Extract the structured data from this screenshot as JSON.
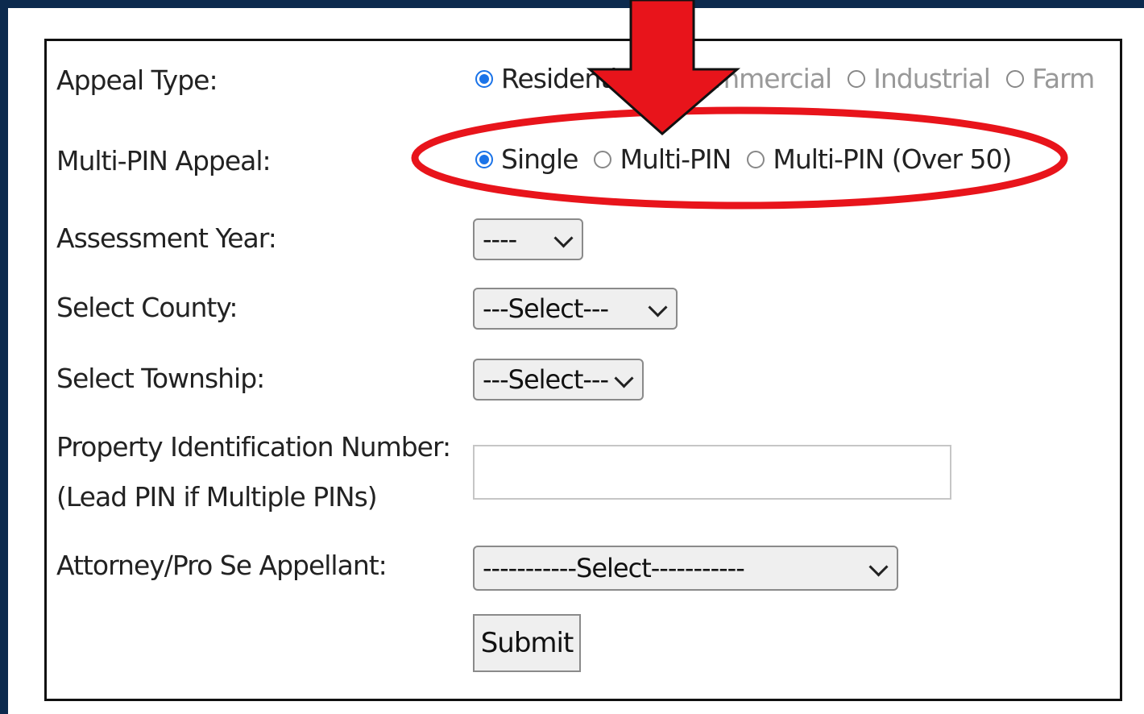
{
  "form": {
    "appeal_type": {
      "label": "Appeal Type:",
      "options": [
        {
          "label": "Residential",
          "checked": true
        },
        {
          "label": "Commercial",
          "checked": false
        },
        {
          "label": "Industrial",
          "checked": false
        },
        {
          "label": "Farm",
          "checked": false
        }
      ]
    },
    "multi_pin": {
      "label": "Multi-PIN Appeal:",
      "options": [
        {
          "label": "Single",
          "checked": true
        },
        {
          "label": "Multi-PIN",
          "checked": false
        },
        {
          "label": "Multi-PIN (Over 50)",
          "checked": false
        }
      ]
    },
    "assessment_year": {
      "label": "Assessment Year:",
      "selected": "----"
    },
    "county": {
      "label": "Select County:",
      "selected": "---Select---"
    },
    "township": {
      "label": "Select Township:",
      "selected": "---Select---"
    },
    "pin": {
      "label_line1": "Property Identification Number:",
      "label_line2": "(Lead PIN if Multiple PINs)",
      "value": ""
    },
    "attorney": {
      "label": "Attorney/Pro Se Appellant:",
      "selected": "-----------Select-----------"
    },
    "submit_label": "Submit"
  },
  "annotation": {
    "color": "#e8141b"
  }
}
